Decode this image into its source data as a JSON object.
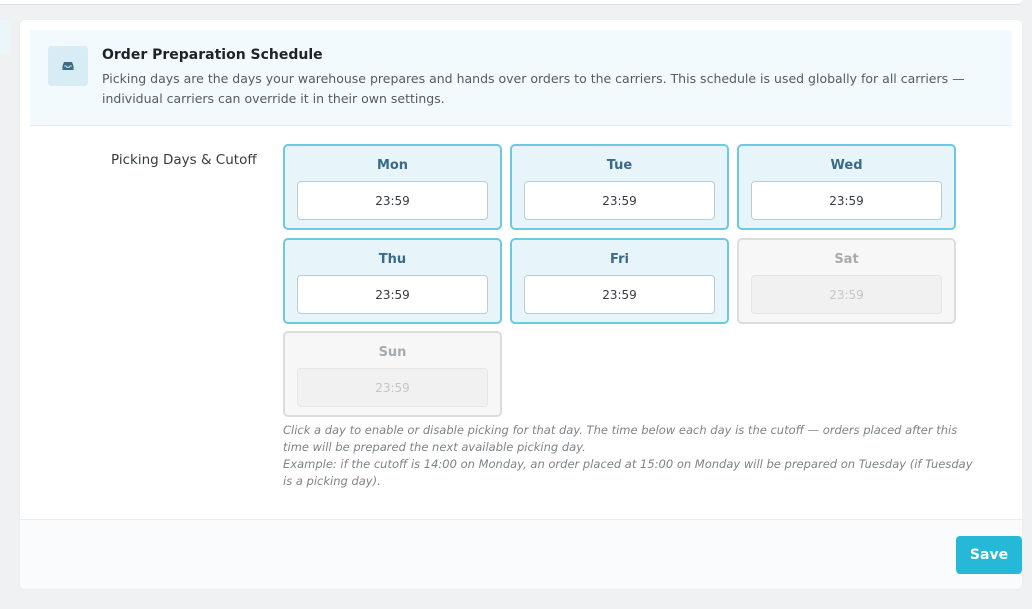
{
  "alert": {
    "icon": "inbox-icon",
    "title": "Order Preparation Schedule",
    "text": "Picking days are the days your warehouse prepares and hands over orders to the carriers. This schedule is used globally for all carriers — individual carriers can override it in their own settings."
  },
  "form": {
    "label": "Picking Days & Cutoff",
    "days": [
      {
        "name": "Mon",
        "time": "23:59",
        "enabled": true
      },
      {
        "name": "Tue",
        "time": "23:59",
        "enabled": true
      },
      {
        "name": "Wed",
        "time": "23:59",
        "enabled": true
      },
      {
        "name": "Thu",
        "time": "23:59",
        "enabled": true
      },
      {
        "name": "Fri",
        "time": "23:59",
        "enabled": true
      },
      {
        "name": "Sat",
        "time": "23:59",
        "enabled": false
      },
      {
        "name": "Sun",
        "time": "23:59",
        "enabled": false
      }
    ],
    "help_line1": "Click a day to enable or disable picking for that day. The time below each day is the cutoff — orders placed after this time will be prepared the next available picking day.",
    "help_line2": "Example: if the cutoff is 14:00 on Monday, an order placed at 15:00 on Monday will be prepared on Tuesday (if Tuesday is a picking day)."
  },
  "footer": {
    "save_label": "Save"
  },
  "colors": {
    "accent": "#25b9d7",
    "active_border": "#6bc9e1",
    "active_bg": "#e7f5fb",
    "disabled_border": "#dcdcdc"
  }
}
